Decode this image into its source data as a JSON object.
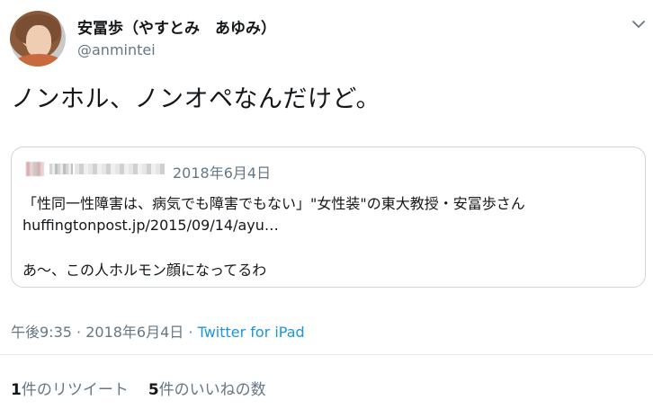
{
  "author": {
    "name": "安冨歩（やすとみ　あゆみ）",
    "handle": "@anmintei"
  },
  "tweet": {
    "text": "ノンホル、ノンオペなんだけど。"
  },
  "quoted_tweet": {
    "date": "2018年6月4日",
    "line1": "「性同一性障害は、病気でも障害でもない」\"女性装\"の東大教授・安冨歩さん",
    "line2": "huffingtonpost.jp/2015/09/14/ayu…",
    "line3": "あ〜、この人ホルモン顔になってるわ"
  },
  "meta": {
    "time": "午後9:35",
    "sep1": " · ",
    "date": "2018年6月4日",
    "sep2": " · ",
    "source": "Twitter for iPad"
  },
  "stats": {
    "retweet_count": "1",
    "retweet_label": "件のリツイート",
    "like_count": "5",
    "like_label": "件のいいねの数"
  },
  "colors": {
    "link": "#1b95e0",
    "secondary": "#657786",
    "border": "#ccd6dd"
  },
  "icons": {
    "menu": "chevron-down-icon"
  }
}
